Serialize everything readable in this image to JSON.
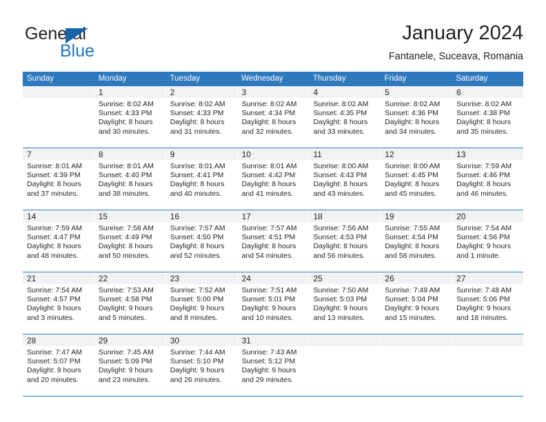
{
  "logo": {
    "word_general": "General",
    "word_blue": "Blue",
    "triangle_color": "#1565a8",
    "blue_color": "#1c75bc"
  },
  "header": {
    "title": "January 2024",
    "subtitle": "Fantanele, Suceava, Romania"
  },
  "theme": {
    "header_bg": "#2e78bd",
    "header_text": "#ffffff",
    "day_band_bg": "#f2f2f2",
    "text": "#231f20"
  },
  "weekdays": [
    "Sunday",
    "Monday",
    "Tuesday",
    "Wednesday",
    "Thursday",
    "Friday",
    "Saturday"
  ],
  "weeks": [
    [
      {
        "day": "",
        "lines": []
      },
      {
        "day": "1",
        "lines": [
          "Sunrise: 8:02 AM",
          "Sunset: 4:33 PM",
          "Daylight: 8 hours",
          "and 30 minutes."
        ]
      },
      {
        "day": "2",
        "lines": [
          "Sunrise: 8:02 AM",
          "Sunset: 4:33 PM",
          "Daylight: 8 hours",
          "and 31 minutes."
        ]
      },
      {
        "day": "3",
        "lines": [
          "Sunrise: 8:02 AM",
          "Sunset: 4:34 PM",
          "Daylight: 8 hours",
          "and 32 minutes."
        ]
      },
      {
        "day": "4",
        "lines": [
          "Sunrise: 8:02 AM",
          "Sunset: 4:35 PM",
          "Daylight: 8 hours",
          "and 33 minutes."
        ]
      },
      {
        "day": "5",
        "lines": [
          "Sunrise: 8:02 AM",
          "Sunset: 4:36 PM",
          "Daylight: 8 hours",
          "and 34 minutes."
        ]
      },
      {
        "day": "6",
        "lines": [
          "Sunrise: 8:02 AM",
          "Sunset: 4:38 PM",
          "Daylight: 8 hours",
          "and 35 minutes."
        ]
      }
    ],
    [
      {
        "day": "7",
        "lines": [
          "Sunrise: 8:01 AM",
          "Sunset: 4:39 PM",
          "Daylight: 8 hours",
          "and 37 minutes."
        ]
      },
      {
        "day": "8",
        "lines": [
          "Sunrise: 8:01 AM",
          "Sunset: 4:40 PM",
          "Daylight: 8 hours",
          "and 38 minutes."
        ]
      },
      {
        "day": "9",
        "lines": [
          "Sunrise: 8:01 AM",
          "Sunset: 4:41 PM",
          "Daylight: 8 hours",
          "and 40 minutes."
        ]
      },
      {
        "day": "10",
        "lines": [
          "Sunrise: 8:01 AM",
          "Sunset: 4:42 PM",
          "Daylight: 8 hours",
          "and 41 minutes."
        ]
      },
      {
        "day": "11",
        "lines": [
          "Sunrise: 8:00 AM",
          "Sunset: 4:43 PM",
          "Daylight: 8 hours",
          "and 43 minutes."
        ]
      },
      {
        "day": "12",
        "lines": [
          "Sunrise: 8:00 AM",
          "Sunset: 4:45 PM",
          "Daylight: 8 hours",
          "and 45 minutes."
        ]
      },
      {
        "day": "13",
        "lines": [
          "Sunrise: 7:59 AM",
          "Sunset: 4:46 PM",
          "Daylight: 8 hours",
          "and 46 minutes."
        ]
      }
    ],
    [
      {
        "day": "14",
        "lines": [
          "Sunrise: 7:59 AM",
          "Sunset: 4:47 PM",
          "Daylight: 8 hours",
          "and 48 minutes."
        ]
      },
      {
        "day": "15",
        "lines": [
          "Sunrise: 7:58 AM",
          "Sunset: 4:49 PM",
          "Daylight: 8 hours",
          "and 50 minutes."
        ]
      },
      {
        "day": "16",
        "lines": [
          "Sunrise: 7:57 AM",
          "Sunset: 4:50 PM",
          "Daylight: 8 hours",
          "and 52 minutes."
        ]
      },
      {
        "day": "17",
        "lines": [
          "Sunrise: 7:57 AM",
          "Sunset: 4:51 PM",
          "Daylight: 8 hours",
          "and 54 minutes."
        ]
      },
      {
        "day": "18",
        "lines": [
          "Sunrise: 7:56 AM",
          "Sunset: 4:53 PM",
          "Daylight: 8 hours",
          "and 56 minutes."
        ]
      },
      {
        "day": "19",
        "lines": [
          "Sunrise: 7:55 AM",
          "Sunset: 4:54 PM",
          "Daylight: 8 hours",
          "and 58 minutes."
        ]
      },
      {
        "day": "20",
        "lines": [
          "Sunrise: 7:54 AM",
          "Sunset: 4:56 PM",
          "Daylight: 9 hours",
          "and 1 minute."
        ]
      }
    ],
    [
      {
        "day": "21",
        "lines": [
          "Sunrise: 7:54 AM",
          "Sunset: 4:57 PM",
          "Daylight: 9 hours",
          "and 3 minutes."
        ]
      },
      {
        "day": "22",
        "lines": [
          "Sunrise: 7:53 AM",
          "Sunset: 4:58 PM",
          "Daylight: 9 hours",
          "and 5 minutes."
        ]
      },
      {
        "day": "23",
        "lines": [
          "Sunrise: 7:52 AM",
          "Sunset: 5:00 PM",
          "Daylight: 9 hours",
          "and 8 minutes."
        ]
      },
      {
        "day": "24",
        "lines": [
          "Sunrise: 7:51 AM",
          "Sunset: 5:01 PM",
          "Daylight: 9 hours",
          "and 10 minutes."
        ]
      },
      {
        "day": "25",
        "lines": [
          "Sunrise: 7:50 AM",
          "Sunset: 5:03 PM",
          "Daylight: 9 hours",
          "and 13 minutes."
        ]
      },
      {
        "day": "26",
        "lines": [
          "Sunrise: 7:49 AM",
          "Sunset: 5:04 PM",
          "Daylight: 9 hours",
          "and 15 minutes."
        ]
      },
      {
        "day": "27",
        "lines": [
          "Sunrise: 7:48 AM",
          "Sunset: 5:06 PM",
          "Daylight: 9 hours",
          "and 18 minutes."
        ]
      }
    ],
    [
      {
        "day": "28",
        "lines": [
          "Sunrise: 7:47 AM",
          "Sunset: 5:07 PM",
          "Daylight: 9 hours",
          "and 20 minutes."
        ]
      },
      {
        "day": "29",
        "lines": [
          "Sunrise: 7:45 AM",
          "Sunset: 5:09 PM",
          "Daylight: 9 hours",
          "and 23 minutes."
        ]
      },
      {
        "day": "30",
        "lines": [
          "Sunrise: 7:44 AM",
          "Sunset: 5:10 PM",
          "Daylight: 9 hours",
          "and 26 minutes."
        ]
      },
      {
        "day": "31",
        "lines": [
          "Sunrise: 7:43 AM",
          "Sunset: 5:12 PM",
          "Daylight: 9 hours",
          "and 29 minutes."
        ]
      },
      {
        "day": "",
        "lines": []
      },
      {
        "day": "",
        "lines": []
      },
      {
        "day": "",
        "lines": []
      }
    ]
  ]
}
